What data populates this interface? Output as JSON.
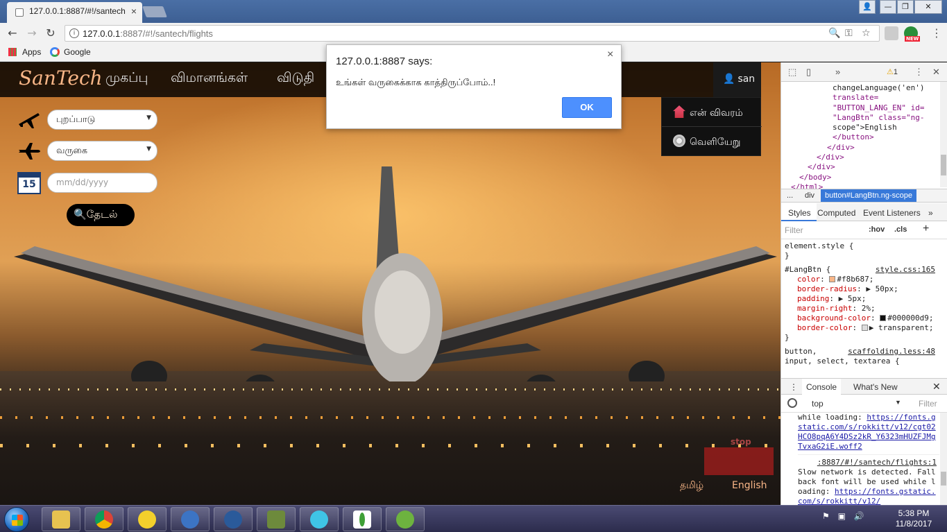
{
  "browser": {
    "tab_title": "127.0.0.1:8887/#!/santech",
    "tab_close": "×",
    "url_host": "127.0.0.1",
    "url_rest": ":8887/#!/santech/flights",
    "bookmarks": [
      {
        "label": "Apps"
      },
      {
        "label": "Google"
      }
    ],
    "ext_badge": "NEW",
    "window_controls": {
      "user": "👤",
      "minimize": "—",
      "maximize": "❐",
      "close": "✕"
    }
  },
  "site": {
    "brand": "SanTech",
    "nav": {
      "home": "முகப்பு",
      "flights": "விமானங்கள்",
      "hotel": "விடுதி"
    },
    "user": "san",
    "dropdown": {
      "profile": "என் விவரம்",
      "logout": "வெளியேறு"
    },
    "search": {
      "departure": "புறப்பாடு",
      "arrival": "வருகை",
      "date_placeholder": "mm/dd/yyyy",
      "calendar_day": "15",
      "button": "🔍தேடல்"
    },
    "languages": {
      "tamil": "தமிழ்",
      "english": "English"
    },
    "stop_sign": "stop"
  },
  "alert": {
    "title": "127.0.0.1:8887 says:",
    "message": "உங்கள் வருகைக்காக காத்திருப்போம்..!",
    "ok": "OK",
    "close": "×"
  },
  "devtools": {
    "warning_count": "1",
    "elements_lines": [
      "changeLanguage('en')",
      "translate=",
      "\"BUTTON_LANG_EN\" id=",
      "\"LangBtn\" class=\"ng-",
      "scope\">English",
      "</button>",
      "</div>",
      "</div>",
      "</div>",
      "</body>",
      "</html>"
    ],
    "breadcrumbs": [
      "...",
      "div",
      "button#LangBtn.ng-scope"
    ],
    "tabs": {
      "styles": "Styles",
      "computed": "Computed",
      "events": "Event Listeners",
      "more": "»"
    },
    "filter": {
      "placeholder": "Filter",
      "hov": ":hov",
      "cls": ".cls",
      "plus": "+"
    },
    "styles": {
      "element_style": "element.style {",
      "close_brace": "}",
      "rule_selector": "#LangBtn {",
      "rule_source": "style.css:165",
      "props": [
        {
          "name": "color",
          "value": "#f8b687;",
          "swatch": "#f8b687"
        },
        {
          "name": "border-radius",
          "value": "▶ 50px;"
        },
        {
          "name": "padding",
          "value": "▶ 5px;"
        },
        {
          "name": "margin-right",
          "value": "2%;"
        },
        {
          "name": "background-color",
          "value": "#000000d9;",
          "swatch": "#000000"
        },
        {
          "name": "border-color",
          "value": "▶ transparent;",
          "swatch": "#dddddd"
        }
      ],
      "next_selector": "button,",
      "next_source": "scaffolding.less:48",
      "next_selector_2": "input, select, textarea {"
    },
    "console": {
      "tab_console": "Console",
      "tab_new": "What's New",
      "context": "top",
      "filter": "Filter",
      "msg1_prefix": "while loading: ",
      "msg1_link": "https://fonts.gstatic.com/s/rokkitt/v12/cgt02HCO8pqA6Y4DSz2kR_Y6323mHUZFJMgTvxaG2iE.woff2",
      "msg2_source": ":8887/#!/santech/flights:1",
      "msg2_text": "Slow network is detected. Fallback font will be used while loading: ",
      "msg2_link": "https://fonts.gstatic.com/s/rokkitt/v12/"
    }
  },
  "taskbar": {
    "time": "5:38 PM",
    "date": "11/8/2017"
  }
}
